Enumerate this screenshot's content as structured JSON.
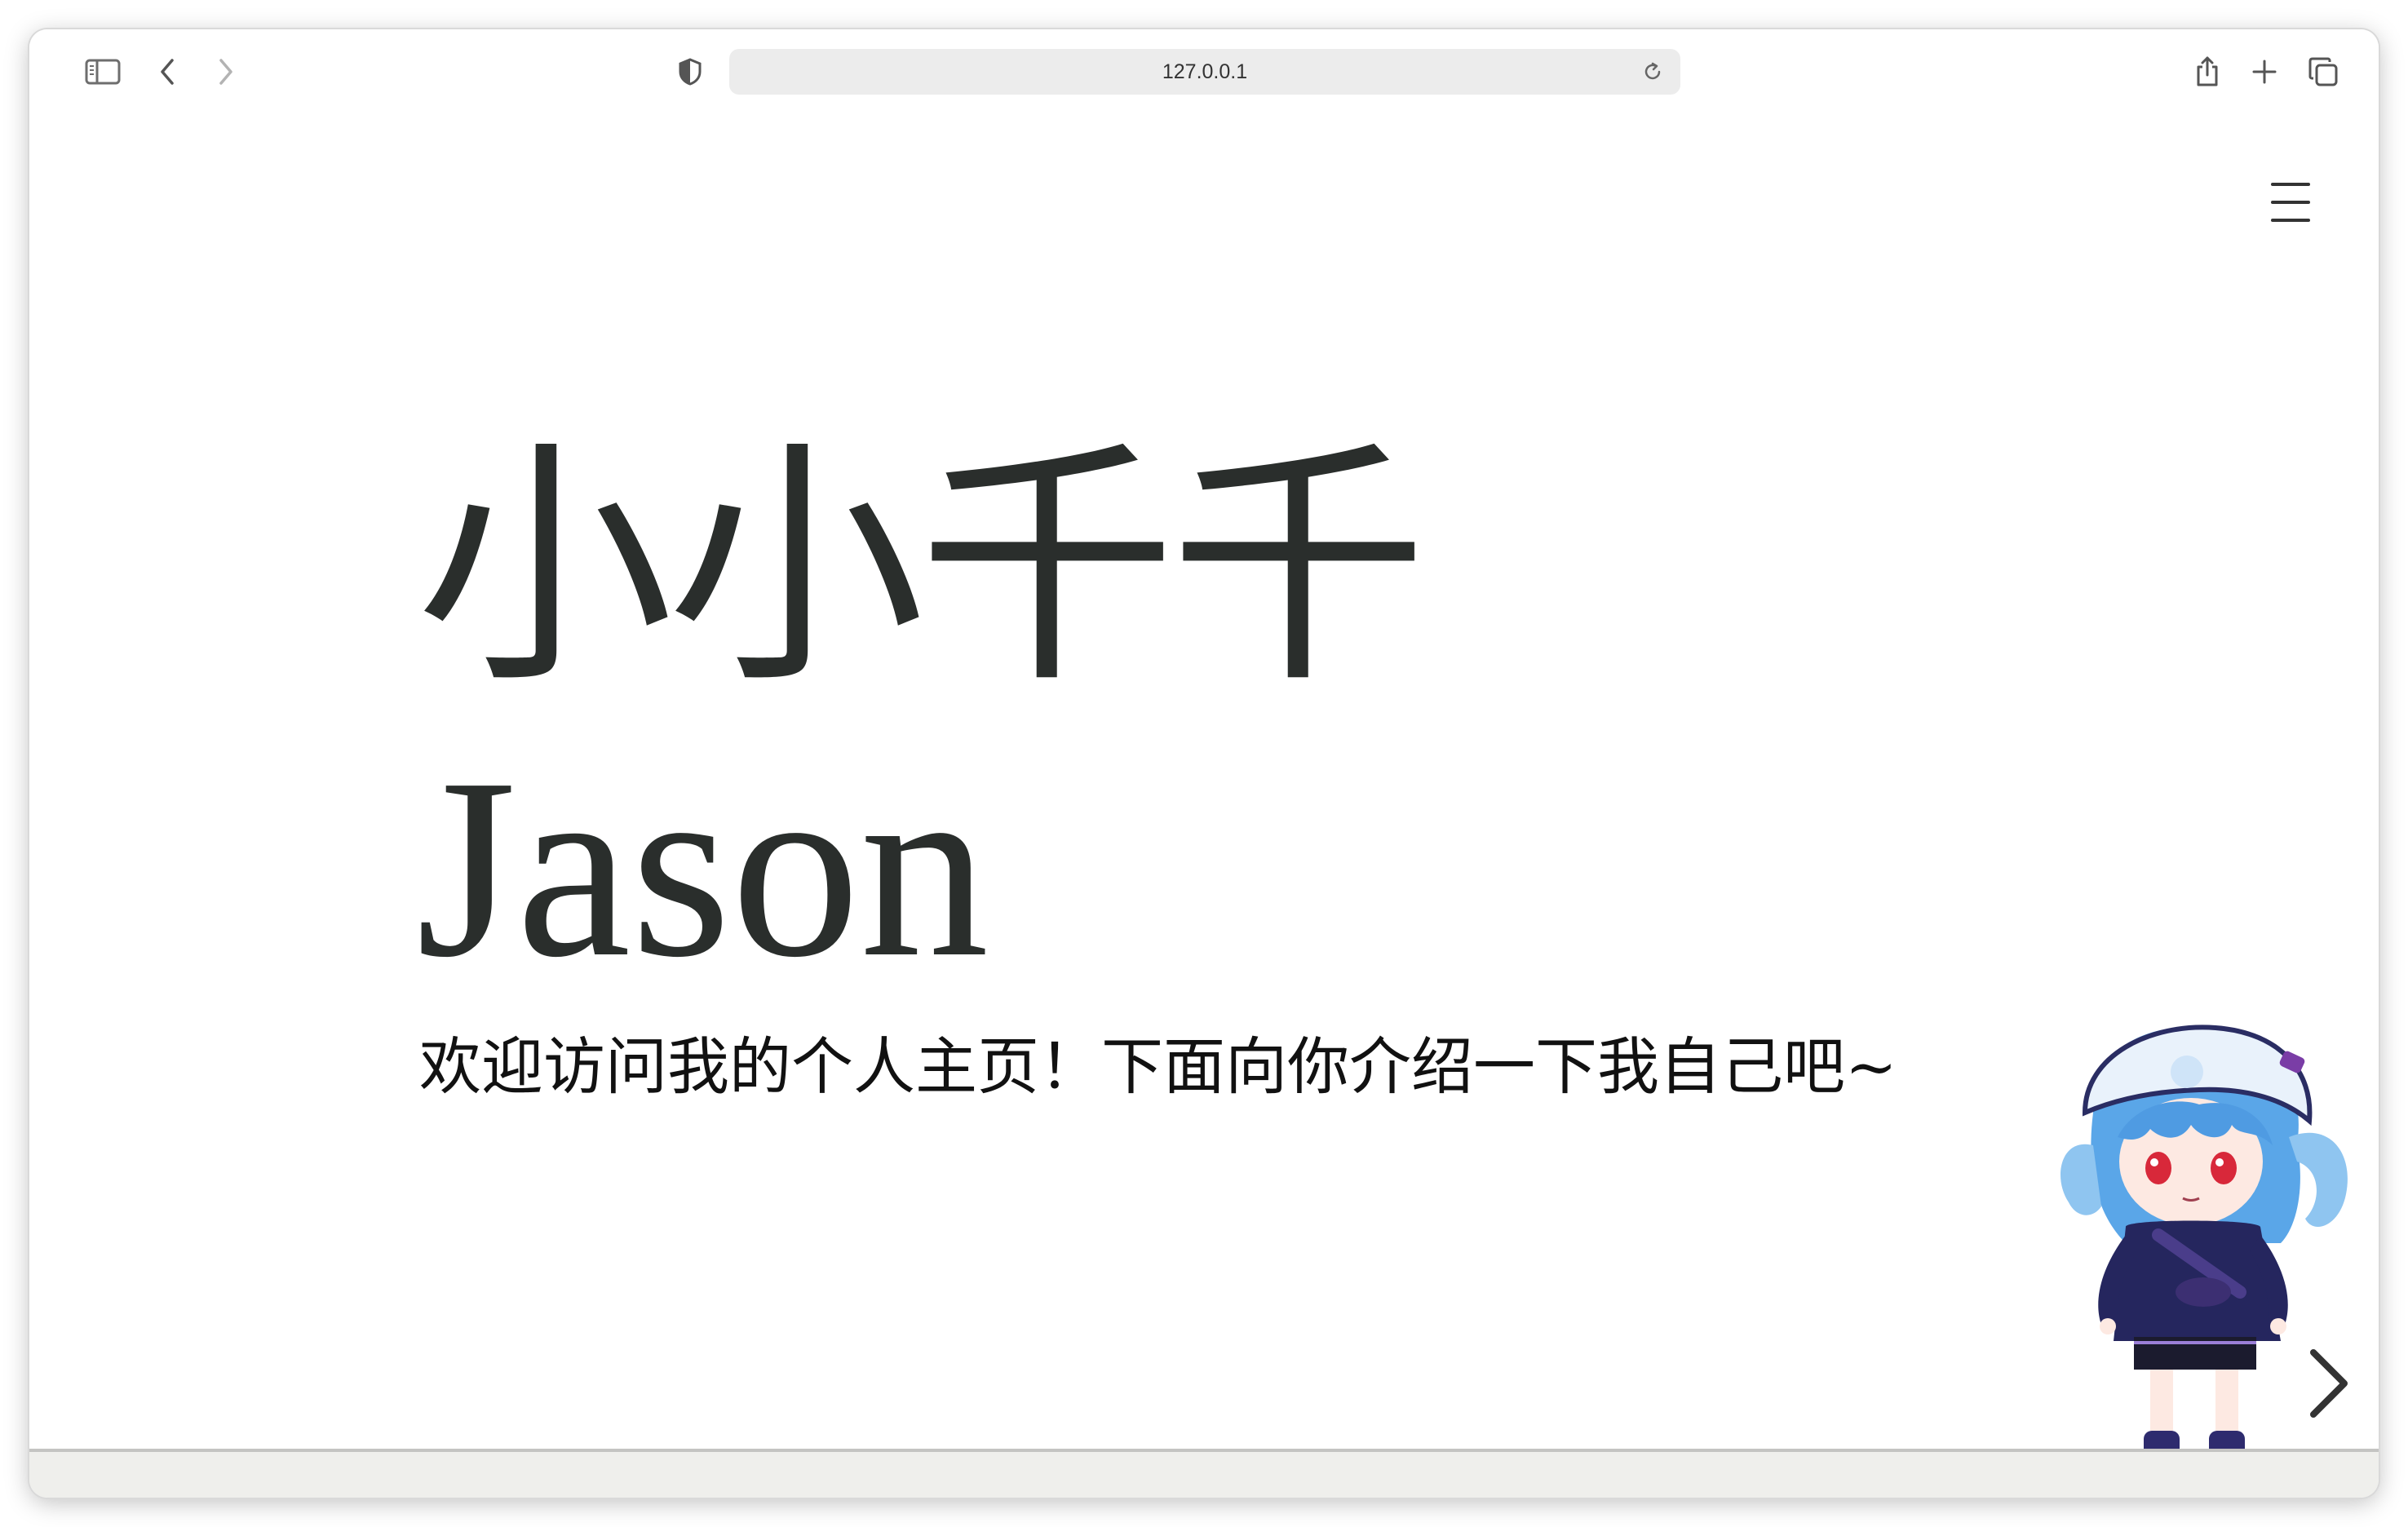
{
  "browser": {
    "url": "127.0.0.1",
    "icons": {
      "sidebar": "sidebar-icon",
      "back": "chevron-left-icon",
      "forward": "chevron-right-icon",
      "privacy": "shield-icon",
      "reload": "reload-icon",
      "share": "share-icon",
      "new_tab": "plus-icon",
      "tabs": "tab-overview-icon"
    }
  },
  "page": {
    "title_cn": "小小千千",
    "title_en": "Jason",
    "subtitle": "欢迎访问我的个人主页！下面向你介绍一下我自己吧~",
    "menu_icon": "hamburger-menu-icon",
    "next_icon": "chevron-right-icon",
    "mascot": "anime-mascot-character"
  },
  "colors": {
    "heading": "#2a2e2c",
    "subtitle": "#111111",
    "address_bar": "#ececec",
    "bottom_bar": "#efefec"
  }
}
